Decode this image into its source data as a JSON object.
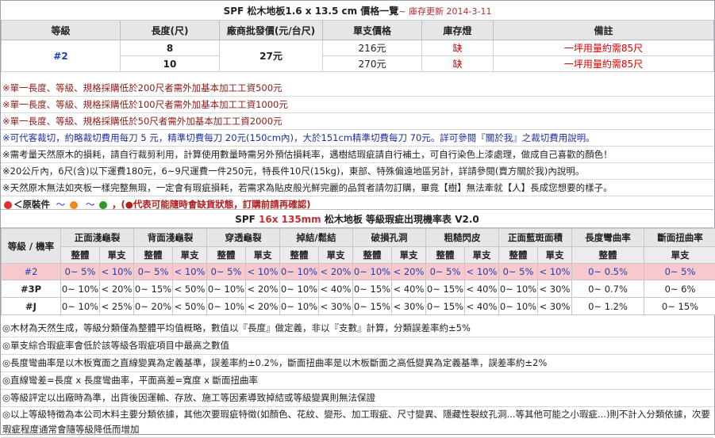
{
  "price_table": {
    "title": "SPF 松木地板1.6 x 13.5 cm 價格一覽",
    "subtitle": "~ 庫存更新 2014-3-11",
    "headers": [
      "等級",
      "長度(尺)",
      "廠商批發價(元/台尺)",
      "單支價格",
      "庫存燈",
      "備註"
    ],
    "grade": "#2",
    "wholesale": "27元",
    "rows": [
      {
        "length": "8",
        "unit_price": "216元",
        "stock": "缺",
        "note": "一坪用量約需85尺"
      },
      {
        "length": "10",
        "unit_price": "270元",
        "stock": "缺",
        "note": "一坪用量約需85尺"
      }
    ]
  },
  "notes": {
    "n1": "※單一長度、等級、規格採購低於200尺者需外加基本加工工資500元",
    "n2": "※單一長度、等級、規格採購低於100尺者需外加基本加工工資1000元",
    "n3": "※單一長度、等級、規格採購低於50尺者需外加基本加工工資2000元",
    "n4": "※可代客裁切，約略裁切費用每刀 5 元，精準切費每刀 20元(150cm內)，大於151cm精準切費每刀 70元。詳可參閱『關於我』之裁切費用說明。",
    "n5": "※需考量天然原木的損耗，請自行裁剪利用，計算使用數量時需另外預估損耗率，遇樹結瑕疵請自行補土，可自行染色上漆處理，做成自己喜歡的顏色！",
    "n6": "※20公斤內，6尺(含)以下運費180元，6~9尺運費一件250元，特長件10尺(15kg)，東部、特殊偏遠地區另計，詳請參閱(賣方關於我)內說明。",
    "n7": "※天然原木無法如夾板一樣完整無瑕，一定會有瑕疵損耗，若需求為貼皮般光鮮完麗的品質者請勿訂購，畢竟【樹】無法牽就【人】長成您想要的樣子。",
    "legend_label": "＜原裝件",
    "legend_tilde1": "～",
    "legend_tilde2": "～",
    "legend_warning": "，(●代表可能隨時會缺貨狀態，訂購前請再確認)",
    "dot_colors": [
      "#e03030",
      "#f08a20",
      "#2a9a2a"
    ]
  },
  "defect_table": {
    "title_prefix": "SPF ",
    "title_mm": "16x 135mm",
    "title_suffix": " 松木地板 等級瑕疵出現機率表 V2.0",
    "corner_label": "等級 / 機率",
    "categories": [
      "正面淺龜裂",
      "背面淺龜裂",
      "穿透龜裂",
      "掉結/鬆結",
      "破損孔洞",
      "粗糙閃皮",
      "正面藍斑面積",
      "長度彎曲率",
      "斷面扭曲率"
    ],
    "sub_a": "整體",
    "sub_b": "單支",
    "rows": [
      {
        "grade": "#2",
        "vals": [
          "0~ 5%",
          "< 10%",
          "0~ 5%",
          "< 10%",
          "0~ 5%",
          "< 10%",
          "0~ 10%",
          "< 20%",
          "0~ 10%",
          "< 20%",
          "0~ 5%",
          "< 10%",
          "0~ 5%",
          "< 10%",
          "0~ 0.5%",
          "0~ 5%"
        ]
      },
      {
        "grade": "#3P",
        "vals": [
          "0~ 10%",
          "< 20%",
          "0~ 15%",
          "< 50%",
          "0~ 10%",
          "< 20%",
          "0~ 10%",
          "< 40%",
          "0~ 15%",
          "< 40%",
          "0~ 15%",
          "< 40%",
          "0~ 10%",
          "< 30%",
          "0~ 0.7%",
          "0~ 6%"
        ]
      },
      {
        "grade": "#J",
        "vals": [
          "0~ 10%",
          "< 25%",
          "0~ 20%",
          "< 50%",
          "0~ 10%",
          "< 20%",
          "0~ 10%",
          "< 30%",
          "0~ 15%",
          "< 30%",
          "0~ 15%",
          "< 40%",
          "0~ 10%",
          "< 30%",
          "0~ 1.2%",
          "0~ 15%"
        ]
      }
    ]
  },
  "footnotes": {
    "f1": "◎木材為天然生成，等級分類僅為整體平均值概略，數值以『長度』做定義，非以『支數』計算，分類誤差率約±5%",
    "f2": "◎單支綜合瑕疵率會低於該等級各瑕疵項目中最高之數值",
    "f3": "◎長度彎曲率是以木板寬面之直線變異為定義基準，誤差率約±0.2%，斷面扭曲率是以木板斷面之高低變異為定義基準，誤差率約±2%",
    "f4": "◎直線彎差=長度 x 長度彎曲率，平面高差=寬度 x 斷面扭曲率",
    "f5": "◎等級評定以出廠時為準，出貨後因運輸、存放、施工等因素導致掉結或等級變異則無法保證",
    "f6": "◎以上等級特徵為本公司木料主要分類依據，其他次要瑕疵特徵(如顏色、花紋、變形、加工瑕疵、尺寸變異、隱藏性裂紋孔洞...等其他可能之小瑕疵...)則不計入分類依據，次要瑕疵程度通常會隨等級降低而增加"
  }
}
